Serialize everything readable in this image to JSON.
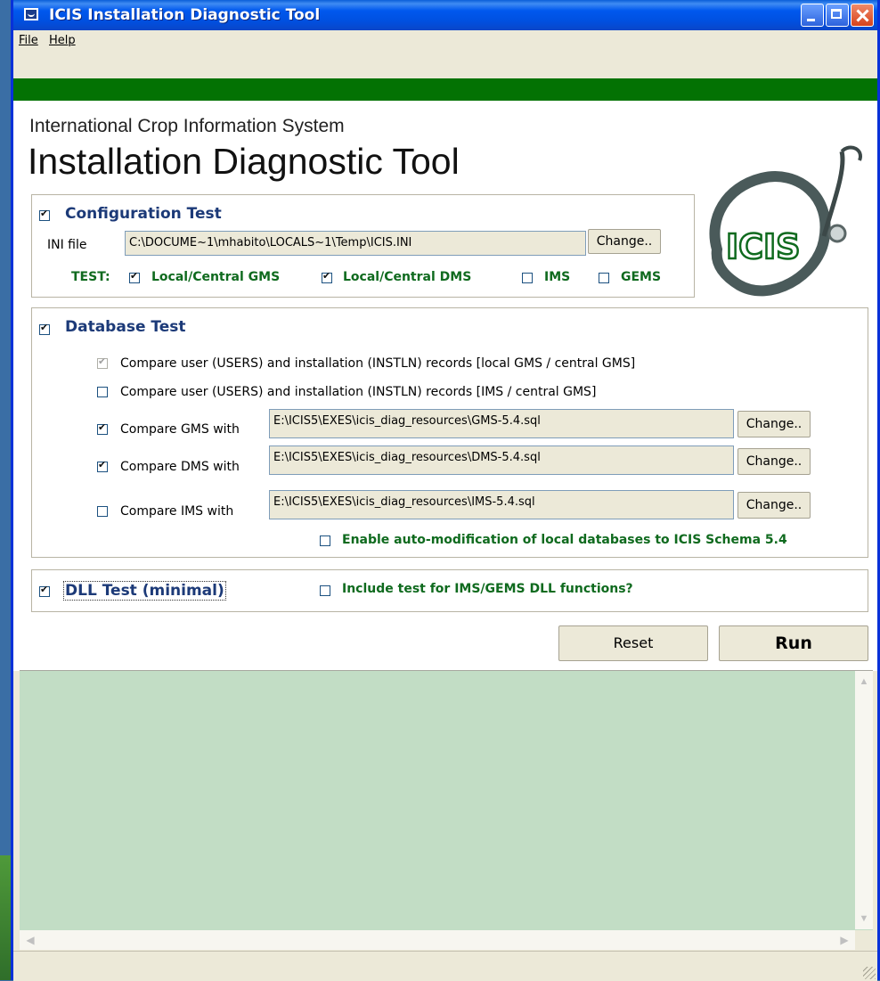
{
  "window": {
    "title": "ICIS Installation Diagnostic Tool"
  },
  "menu": {
    "file": "File",
    "help": "Help"
  },
  "header": {
    "subtitle": "International Crop Information System",
    "title": "Installation Diagnostic Tool",
    "logo_text": "ICIS"
  },
  "config_test": {
    "checked": true,
    "title": "Configuration Test",
    "ini_label": "INI file",
    "ini_value": "C:\\DOCUME~1\\mhabito\\LOCALS~1\\Temp\\ICIS.INI",
    "change_label": "Change..",
    "test_label": "TEST:",
    "options": [
      {
        "label": "Local/Central GMS",
        "checked": true
      },
      {
        "label": "Local/Central DMS",
        "checked": true
      },
      {
        "label": "IMS",
        "checked": false
      },
      {
        "label": "GEMS",
        "checked": false
      }
    ]
  },
  "database_test": {
    "checked": true,
    "title": "Database Test",
    "compare_local": {
      "label": "Compare user (USERS) and installation (INSTLN) records [local GMS / central GMS]",
      "checked": true,
      "disabled": true
    },
    "compare_ims": {
      "label": "Compare user (USERS) and installation (INSTLN) records [IMS / central GMS]",
      "checked": false
    },
    "compare_gms": {
      "label": "Compare GMS with",
      "checked": true,
      "path": "E:\\ICIS5\\EXES\\icis_diag_resources\\GMS-5.4.sql",
      "change_label": "Change.."
    },
    "compare_dms": {
      "label": "Compare DMS with",
      "checked": true,
      "path": "E:\\ICIS5\\EXES\\icis_diag_resources\\DMS-5.4.sql",
      "change_label": "Change.."
    },
    "compare_ims_file": {
      "label": "Compare IMS with",
      "checked": false,
      "path": "E:\\ICIS5\\EXES\\icis_diag_resources\\IMS-5.4.sql",
      "change_label": "Change.."
    },
    "auto_mod": {
      "label": "Enable auto-modification of local databases to ICIS Schema 5.4",
      "checked": false
    }
  },
  "dll_test": {
    "checked": true,
    "title": "DLL Test (minimal)",
    "include": {
      "label": "Include test for IMS/GEMS DLL functions?",
      "checked": false
    }
  },
  "actions": {
    "reset": "Reset",
    "run": "Run"
  },
  "colors": {
    "title_blue": "#1c3a78",
    "label_green": "#0f6a1e",
    "banner_green": "#037203",
    "output_bg": "#c2ddc5"
  }
}
